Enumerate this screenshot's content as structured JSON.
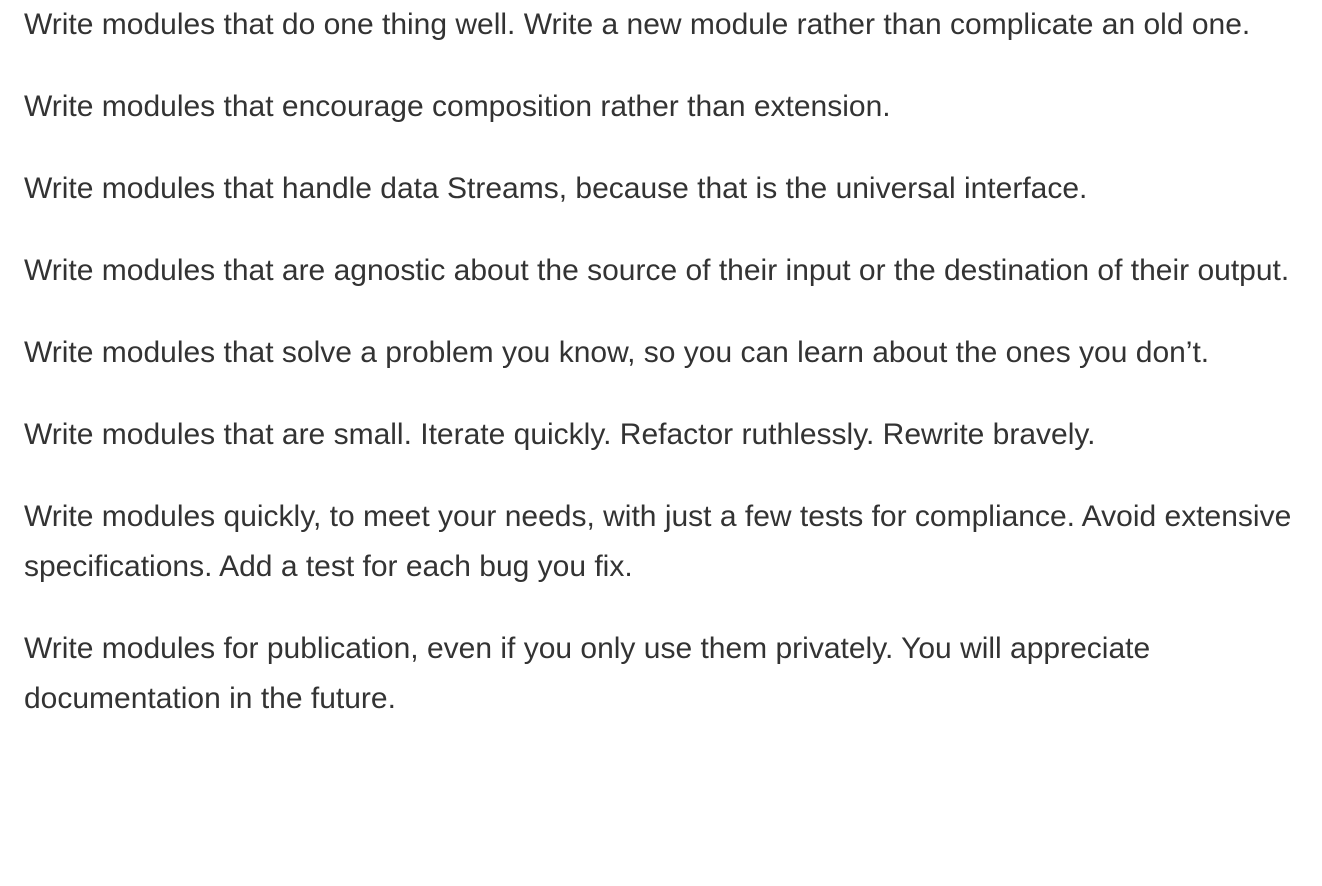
{
  "paragraphs": [
    "Write modules that do one thing well. Write a new module rather than complicate an old one.",
    "Write modules that encourage composition rather than extension.",
    "Write modules that handle data Streams, because that is the universal interface.",
    "Write modules that are agnostic about the source of their input or the destination of their output.",
    "Write modules that solve a problem you know, so you can learn about the ones you don’t.",
    "Write modules that are small. Iterate quickly. Refactor ruthlessly. Rewrite bravely.",
    "Write modules quickly, to meet your needs, with just a few tests for compliance. Avoid extensive specifications. Add a test for each bug you fix.",
    "Write modules for publication, even if you only use them privately. You will appreciate documentation in the future."
  ],
  "colors": {
    "text": "#333333",
    "background": "#ffffff"
  }
}
